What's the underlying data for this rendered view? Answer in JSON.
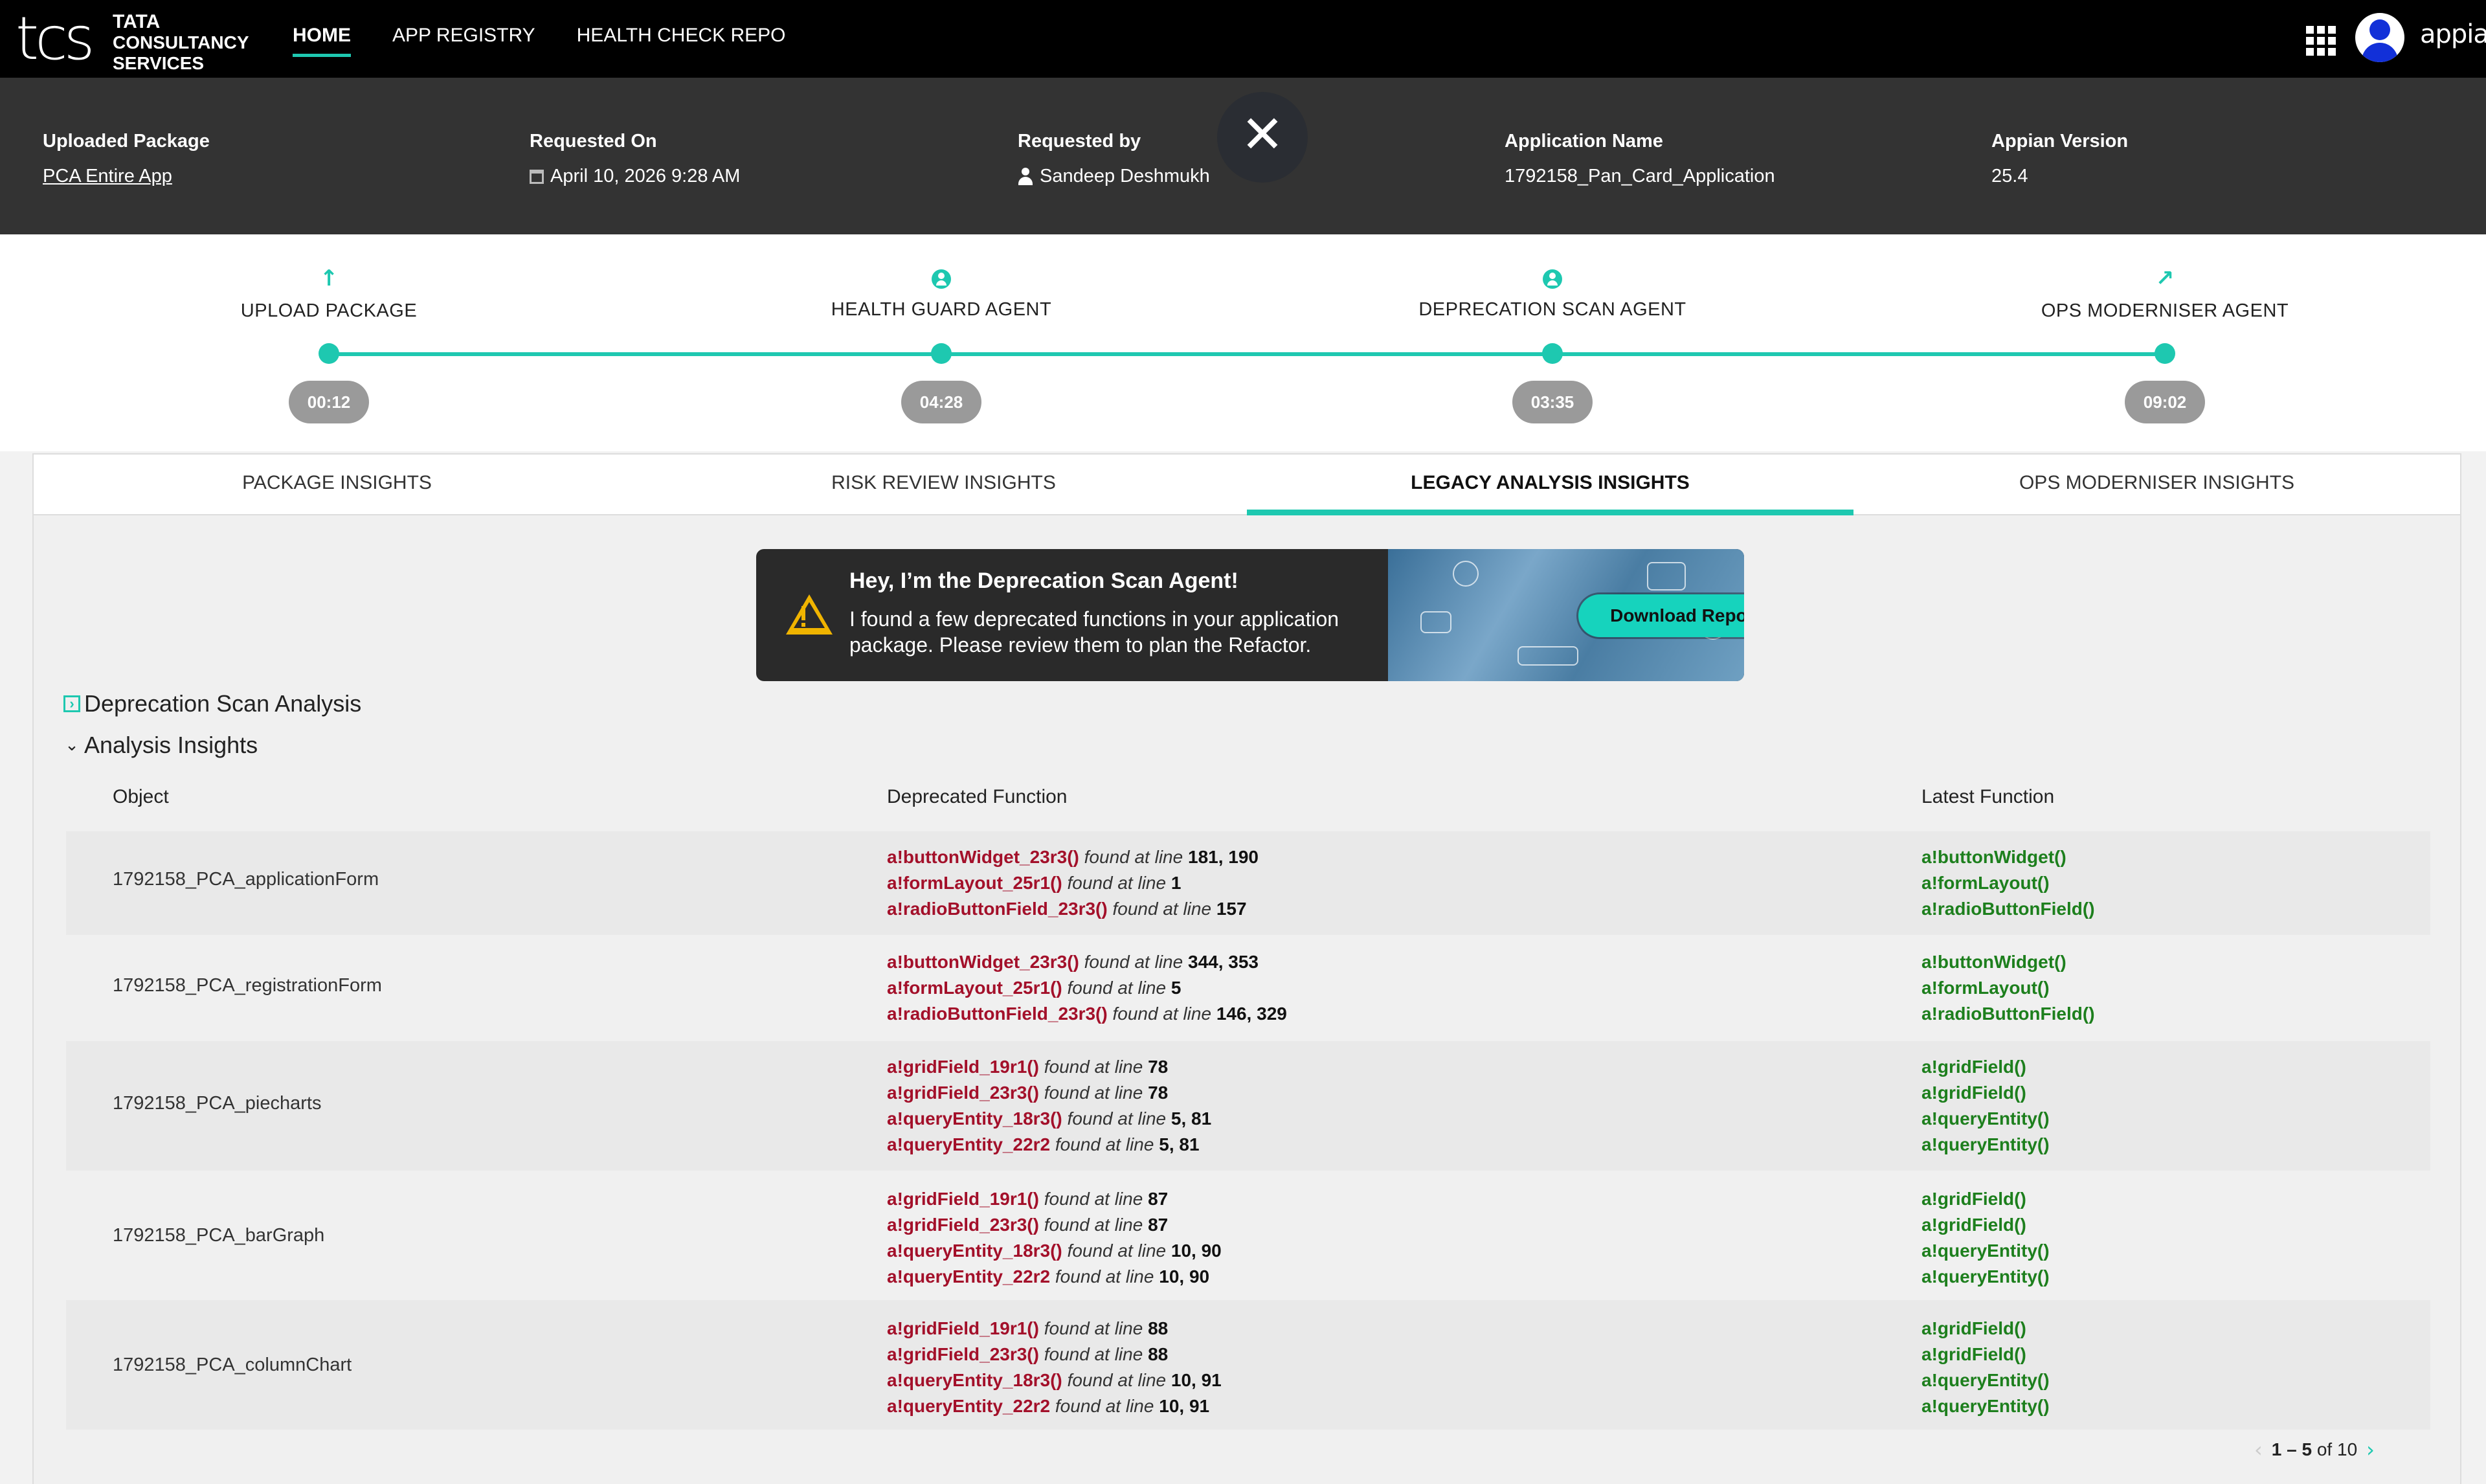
{
  "brand": {
    "logo_mark": "tcs",
    "logo_line1": "TATA",
    "logo_line2": "CONSULTANCY",
    "logo_line3": "SERVICES",
    "app_name": "appian",
    "accent": "#1ec8b0"
  },
  "nav": {
    "items": [
      {
        "label": "HOME",
        "active": true
      },
      {
        "label": "APP REGISTRY"
      },
      {
        "label": "HEALTH CHECK REPO"
      }
    ]
  },
  "info": {
    "uploaded_label": "Uploaded Package",
    "uploaded_value": "PCA Entire App",
    "requested_on_label": "Requested On",
    "requested_on_value": "April 10, 2026 9:28 AM",
    "requested_by_label": "Requested by",
    "requested_by_value": "Sandeep Deshmukh",
    "app_name_label": "Application Name",
    "app_name_value": "1792158_Pan_Card_Application",
    "version_label": "Appian Version",
    "version_value": "25.4",
    "close_glyph": "✕"
  },
  "steps": [
    {
      "label": "UPLOAD PACKAGE",
      "time": "00:12",
      "icon": "upload-arrow-icon",
      "glyph": "↑"
    },
    {
      "label": "HEALTH GUARD AGENT",
      "time": "04:28",
      "icon": "agent-person-icon"
    },
    {
      "label": "DEPRECATION SCAN AGENT",
      "time": "03:35",
      "icon": "agent-person-icon"
    },
    {
      "label": "OPS MODERNISER AGENT",
      "time": "09:02",
      "icon": "arrow-up-right-icon",
      "glyph": "↗"
    }
  ],
  "tabs": [
    {
      "label": "PACKAGE INSIGHTS"
    },
    {
      "label": "RISK REVIEW INSIGHTS"
    },
    {
      "label": "LEGACY ANALYSIS INSIGHTS",
      "active": true
    },
    {
      "label": "OPS MODERNISER INSIGHTS"
    }
  ],
  "banner": {
    "title": "Hey, I’m the Deprecation Scan Agent!",
    "text": "I found a few deprecated functions in your application package. Please review them to plan the Refactor.",
    "button": "Download Report"
  },
  "sections": {
    "scan_title": "Deprecation Scan Analysis",
    "insights_title": "Analysis Insights"
  },
  "table": {
    "headers": {
      "object": "Object",
      "deprecated": "Deprecated Function",
      "latest": "Latest Function"
    },
    "rows": [
      {
        "object": "1792158_PCA_applicationForm",
        "deprecated": [
          {
            "fn": "a!buttonWidget_23r3()",
            "found": "found at line",
            "lines": "181, 190"
          },
          {
            "fn": "a!formLayout_25r1()",
            "found": "found at line",
            "lines": "1"
          },
          {
            "fn": "a!radioButtonField_23r3()",
            "found": "found at line",
            "lines": "157"
          }
        ],
        "latest": [
          "a!buttonWidget()",
          "a!formLayout()",
          "a!radioButtonField()"
        ]
      },
      {
        "object": "1792158_PCA_registrationForm",
        "deprecated": [
          {
            "fn": "a!buttonWidget_23r3()",
            "found": "found at line",
            "lines": "344, 353"
          },
          {
            "fn": "a!formLayout_25r1()",
            "found": "found at line",
            "lines": "5"
          },
          {
            "fn": "a!radioButtonField_23r3()",
            "found": "found at line",
            "lines": "146, 329"
          }
        ],
        "latest": [
          "a!buttonWidget()",
          "a!formLayout()",
          "a!radioButtonField()"
        ]
      },
      {
        "object": "1792158_PCA_piecharts",
        "deprecated": [
          {
            "fn": "a!gridField_19r1()",
            "found": "found at line",
            "lines": "78"
          },
          {
            "fn": "a!gridField_23r3()",
            "found": "found at line",
            "lines": "78"
          },
          {
            "fn": "a!queryEntity_18r3()",
            "found": "found at line",
            "lines": "5, 81"
          },
          {
            "fn": "a!queryEntity_22r2",
            "found": "found at line",
            "lines": "5, 81"
          }
        ],
        "latest": [
          "a!gridField()",
          "a!gridField()",
          "a!queryEntity()",
          "a!queryEntity()"
        ]
      },
      {
        "object": "1792158_PCA_barGraph",
        "deprecated": [
          {
            "fn": "a!gridField_19r1()",
            "found": "found at line",
            "lines": "87"
          },
          {
            "fn": "a!gridField_23r3()",
            "found": "found at line",
            "lines": "87"
          },
          {
            "fn": "a!queryEntity_18r3()",
            "found": "found at line",
            "lines": "10, 90"
          },
          {
            "fn": "a!queryEntity_22r2",
            "found": "found at line",
            "lines": "10, 90"
          }
        ],
        "latest": [
          "a!gridField()",
          "a!gridField()",
          "a!queryEntity()",
          "a!queryEntity()"
        ]
      },
      {
        "object": "1792158_PCA_columnChart",
        "deprecated": [
          {
            "fn": "a!gridField_19r1()",
            "found": "found at line",
            "lines": "88"
          },
          {
            "fn": "a!gridField_23r3()",
            "found": "found at line",
            "lines": "88"
          },
          {
            "fn": "a!queryEntity_18r3()",
            "found": "found at line",
            "lines": "10, 91"
          },
          {
            "fn": "a!queryEntity_22r2",
            "found": "found at line",
            "lines": "10, 91"
          }
        ],
        "latest": [
          "a!gridField()",
          "a!gridField()",
          "a!queryEntity()",
          "a!queryEntity()"
        ]
      }
    ]
  },
  "pagination": {
    "range": "1 – 5",
    "of_label": "of",
    "total": "10",
    "prev_glyph": "‹",
    "next_glyph": "›"
  }
}
